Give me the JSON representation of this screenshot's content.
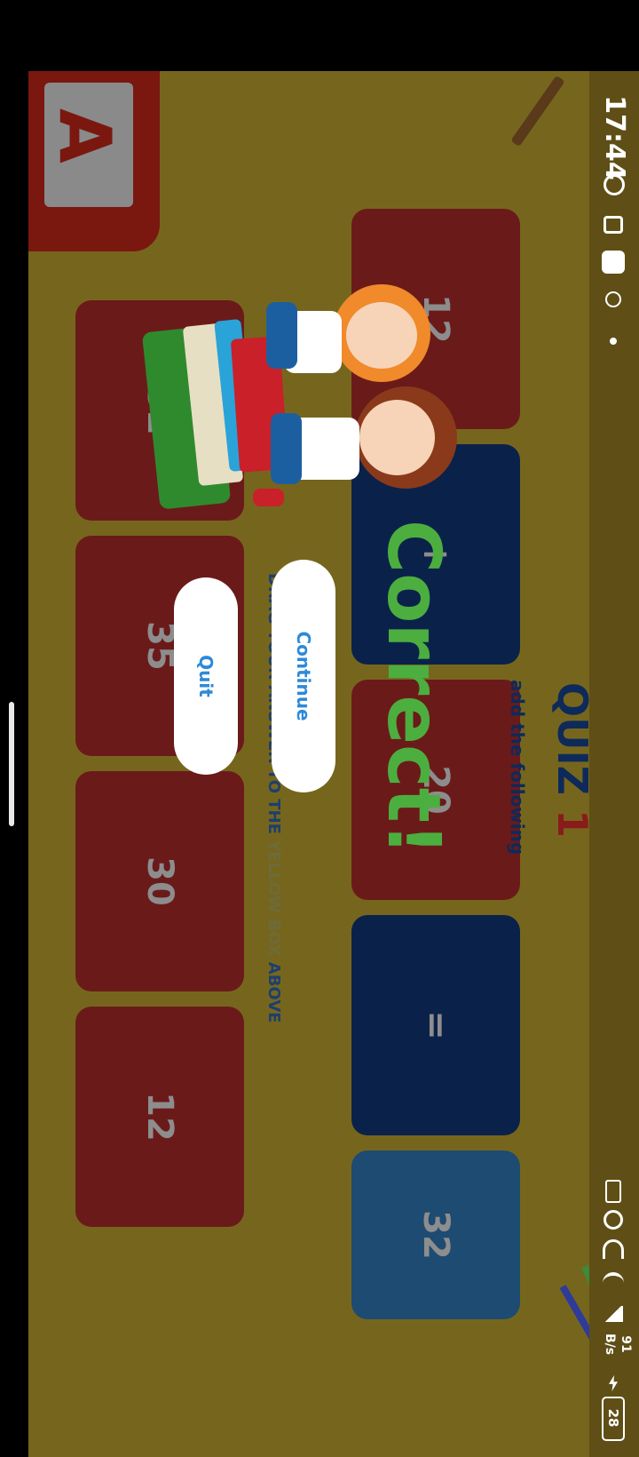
{
  "status": {
    "time": "17:44",
    "battery": "28",
    "net_speed_value": "91",
    "net_speed_unit": "B/s"
  },
  "quiz": {
    "title_word": "QUIZ",
    "title_number": "1",
    "subtitle": "add the following",
    "instruction_part1": "DRAG YOUR ANSWER TO THE ",
    "instruction_part2": "YELLOW BOX",
    "instruction_part3": " ABOVE",
    "equation": {
      "operand1": "12",
      "operator": "+",
      "operand2": "20",
      "equals": "=",
      "answer": "32"
    },
    "choices": [
      "32",
      "35",
      "30",
      "12"
    ]
  },
  "overlay": {
    "message": "Correct!",
    "continue_label": "Continue",
    "quit_label": "Quit"
  },
  "colors": {
    "background": "#76661d",
    "tile_red": "#6b1a1a",
    "tile_navy": "#0a224a",
    "tile_answer": "#1d4b72",
    "correct_green": "#4cae3f",
    "button_text": "#2d8ad8"
  }
}
